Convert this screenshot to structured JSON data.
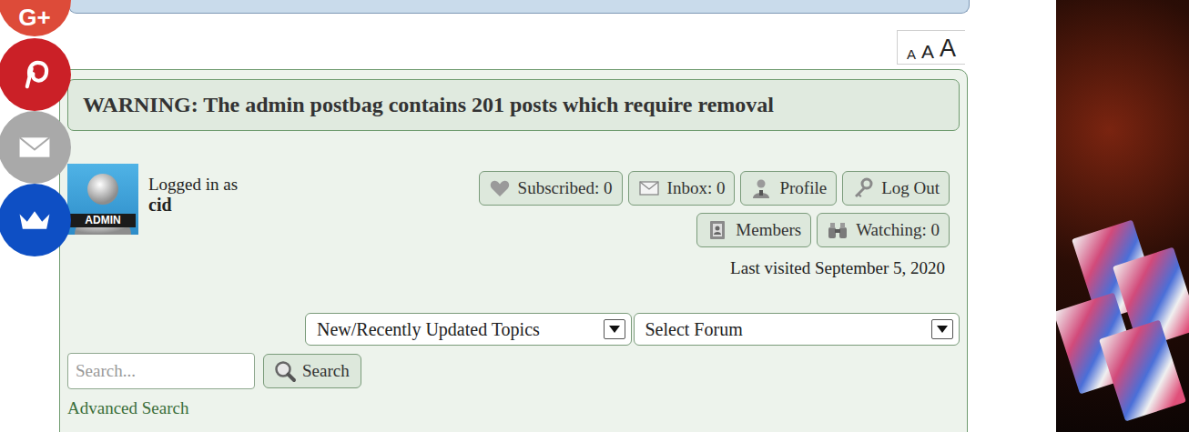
{
  "share_buttons": [
    {
      "kind": "gplus",
      "label": "G+",
      "color": "#dd4b39"
    },
    {
      "kind": "pinterest",
      "color": "#cb2027"
    },
    {
      "kind": "email",
      "color": "#a9a9a9"
    },
    {
      "kind": "crown",
      "color": "#0e4fc4"
    }
  ],
  "font_size": {
    "labels": [
      "A",
      "A",
      "A"
    ]
  },
  "warning": "WARNING: The admin postbag contains 201 posts which require removal",
  "user": {
    "logged_in_label": "Logged in as",
    "username": "cid",
    "avatar_label": "ADMIN"
  },
  "buttons": [
    [
      {
        "kind": "heart",
        "label": "Subscribed: 0"
      },
      {
        "kind": "mail",
        "label": "Inbox: 0"
      },
      {
        "kind": "profile",
        "label": "Profile"
      },
      {
        "kind": "key",
        "label": "Log Out"
      }
    ],
    [
      {
        "kind": "members",
        "label": "Members"
      },
      {
        "kind": "watching",
        "label": "Watching: 0"
      }
    ]
  ],
  "last_visited": "Last visited September 5, 2020",
  "selects": [
    {
      "value": "New/Recently Updated Topics"
    },
    {
      "value": "Select Forum"
    }
  ],
  "search": {
    "placeholder": "Search...",
    "button": "Search"
  },
  "advanced_search": "Advanced Search"
}
